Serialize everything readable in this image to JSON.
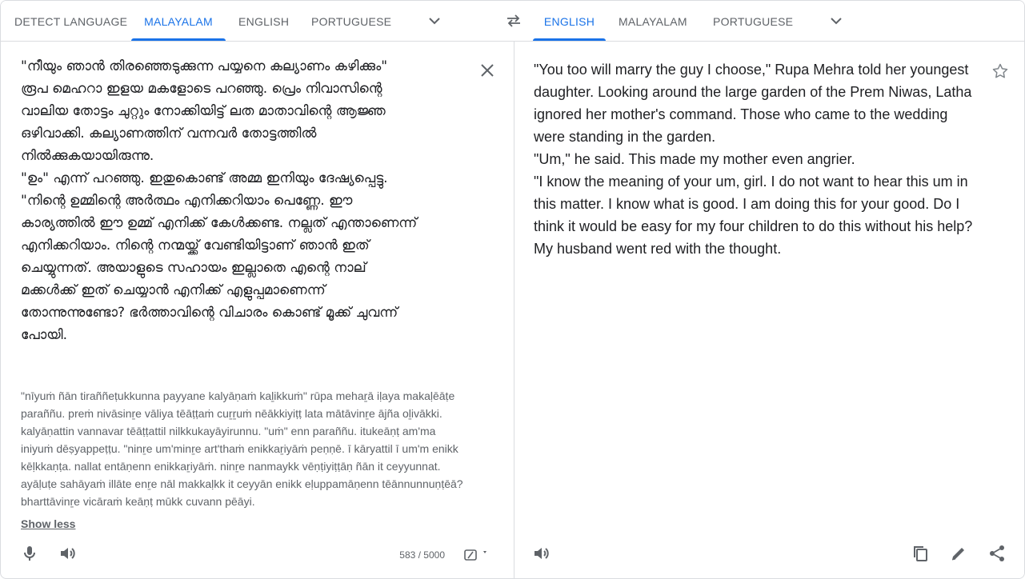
{
  "source_langs": {
    "tabs": [
      {
        "label": "Detect language"
      },
      {
        "label": "Malayalam"
      },
      {
        "label": "English"
      },
      {
        "label": "Portuguese"
      }
    ],
    "active": "Malayalam"
  },
  "target_langs": {
    "tabs": [
      {
        "label": "English"
      },
      {
        "label": "Malayalam"
      },
      {
        "label": "Portuguese"
      }
    ],
    "active": "English"
  },
  "source": {
    "text": "\"നീയും ഞാൻ തിരഞ്ഞെടുക്കുന്ന പയ്യനെ കല്യാണം കഴിക്കും\"\nരൂപ മെഹറാ ഇളയ മകളോടെ പറഞ്ഞു. പ്രെം നിവാസിന്റെ\nവാലിയ തോട്ടം ചുറ്റും നോക്കിയിട്ട് ലത മാതാവിന്റെ ആജ്ഞ\nഒഴിവാക്കി. കല്യാണത്തിന് വന്നവർ തോട്ടത്തിൽ\nനിൽക്കുകയായിരുന്നു.\n\"ഉം\" എന്ന് പറഞ്ഞു. ഇതുകൊണ്ട് അമ്മ ഇനിയും ദേഷ്യപ്പെട്ടു.\n\"നിന്റെ ഉമ്മിന്റെ അർത്ഥം എനിക്കറിയാം പെണ്ണേ. ഈ\nകാര്യത്തിൽ ഈ ഉമ്മ് എനിക്ക് കേൾക്കണ്ട. നല്ലത് എന്താണെന്ന്\nഎനിക്കറിയാം. നിന്റെ നന്മയ്ക്ക് വേണ്ടിയിട്ടാണ് ഞാൻ ഇത്\nചെയ്യുന്നത്. അയാളുടെ സഹായം ഇല്ലാതെ എന്റെ നാല്\nമക്കൾക്ക് ഇത് ചെയ്യാൻ എനിക്ക് എളുപ്പമാണെന്ന്\nതോന്നുന്നുണ്ടോ? ഭർത്താവിന്റെ വിചാരം കൊണ്ട് മൂക്ക് ചുവന്ന്\nപോയി.",
    "transliteration": "\"nīyuṁ ñān tiraññeṭukkunna payyane kalyāṇaṁ kaḻikkuṁ\" rūpa mehaṟā iḷaya makaḷēāṭe\nparaññu. preṁ nivāsinṟe vāliya tēāṭṭaṁ cuṟṟuṁ nēākkiyiṭṭ lata mātāvinṟe ājña oḻivākki.\nkalyāṇattin vannavar tēāṭṭattil nilkkukayāyirunnu. \"uṁ\" enn paraññu. itukeāṇṭ am'ma\niniyuṁ dēṣyappeṭṭu. \"ninṟe um'minṟe art'thaṁ enikkaṟiyāṁ peṇṇē. ī kāryattil ī um'm enikk\nkēḷkkaṇṭa. nallat entāṇenn enikkaṟiyāṁ. ninṟe nanmaykk vēṇṭiyiṭṭāṇ ñān it ceyyunnat.\nayāḷuṭe sahāyaṁ illāte enṟe nāl makkaḷkk it ceyyān enikk eḷuppamāṇenn tēānnunnuṇṭēā?\nbharttāvinṟe vicāraṁ keāṇṭ mūkk cuvann pēāyi.",
    "show_less": "Show less",
    "char_count": "583 / 5000"
  },
  "target": {
    "text": "\"You too will marry the guy I choose,\" Rupa Mehra told her youngest\ndaughter. Looking around the large garden of the Prem Niwas, Latha\nignored her mother's command. Those who came to the wedding\nwere standing in the garden.\n\"Um,\" he said. This made my mother even angrier.\n\"I know the meaning of your um, girl. I do not want to hear this um in\nthis matter. I know what is good. I am doing this for your good. Do I\nthink it would be easy for my four children to do this without his help?\nMy husband went red with the thought."
  }
}
